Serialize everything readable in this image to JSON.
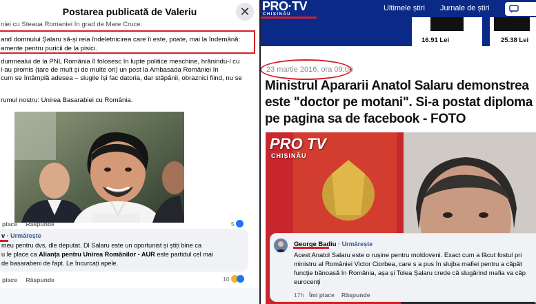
{
  "left": {
    "header_title": "Postarea publicată de Valeriu",
    "close_glyph": "✕",
    "lines": [
      "niei cu Steaua Romaniei în grad de Mare Cruce.",
      "and domnului Șalaru să-și reia îndeletnicirea care îi este, poate, mai la îndemână:",
      "amente pentru puricii de la pisici.",
      "dumnealui de la PNL România îl folosesc în lupte politice meschine, hrănindu-l cu",
      " l-au promis (tare de mult și de multe ori) un post la Ambasada României în",
      "cum se întâmplă adesea – slugile își fac datoria, dar stăpânii, obraznici fiind,  nu se",
      "rumul nostru: Unirea Basarabiei cu România."
    ],
    "photo_icon": "photo-of-man",
    "comment1": {
      "meta_top": {
        "like": "place",
        "reply": "Răspunde",
        "count": "5"
      },
      "author_suffix": "v",
      "follow": "· Urmărește",
      "line1": " meu pentru dvs, dle deputat. Dl Salaru este un oportunist și știți bine ca",
      "line2_pre": "u le place ca ",
      "line2_bold": "Alianța pentru Unirea Românilor - AUR",
      "line2_post": " este partidul cel mai",
      "line3": "de basarabeni de fapt. Le încurcați apele.",
      "like": "place",
      "reply": "Răspunde",
      "count": "10"
    }
  },
  "right": {
    "logo": "PRO·TV",
    "logo_sub": "CHIȘINĂU",
    "nav": [
      "Ultimele știri",
      "Jurnale de știri"
    ],
    "prices": [
      "16.91 Lei",
      "25.38 Lei"
    ],
    "date": "23 martie 2016, ora 09:06",
    "headline": [
      "Ministrul Apararii Anatol Salaru demonstrea",
      "este \"doctor pe motani\". Si-a postat diploma",
      "pe pagina sa de facebook - FOTO"
    ],
    "image_overlay_logo": "PRO TV",
    "image_overlay_sub": "CHIȘINĂU",
    "comment": {
      "author": "George Badiu",
      "follow": "· Urmărește",
      "lines": [
        "Acest Anatol Salaru este o rușine pentru moldoveni. Exact cum a făcut fostul pri",
        "ministru al României Victor Ciorbea, care s a pus în slujba mafiei pentru a căpăt",
        "funcție bănoasă în România, așa și Tolea Șalaru crede că slugărind mafia va căp",
        "eurocenți"
      ],
      "time": "17h",
      "like": "Îmi place",
      "reply": "Răspunde"
    }
  },
  "colors": {
    "accent_red": "#d4202a",
    "protv_blue": "#0b2a87",
    "fb_link": "#385898",
    "comment_bg": "#f0f2f5"
  }
}
